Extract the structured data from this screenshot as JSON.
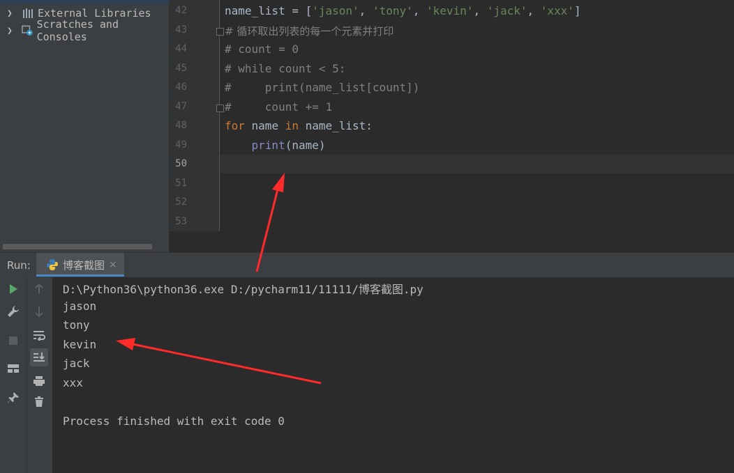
{
  "project_tree": {
    "items": [
      {
        "label": "External Libraries",
        "icon": "library-icon"
      },
      {
        "label": "Scratches and Consoles",
        "icon": "scratches-icon"
      }
    ]
  },
  "editor": {
    "lines": [
      {
        "n": "42",
        "text": "name_list = ['jason', 'tony', 'kevin', 'jack', 'xxx']"
      },
      {
        "n": "43",
        "text": "# 循环取出列表的每一个元素并打印"
      },
      {
        "n": "44",
        "text": "# count = 0"
      },
      {
        "n": "45",
        "text": "# while count < 5:"
      },
      {
        "n": "46",
        "text": "#     print(name_list[count])"
      },
      {
        "n": "47",
        "text": "#     count += 1"
      },
      {
        "n": "48",
        "text": "for name in name_list:"
      },
      {
        "n": "49",
        "text": "    print(name)"
      },
      {
        "n": "50",
        "text": ""
      },
      {
        "n": "51",
        "text": ""
      },
      {
        "n": "52",
        "text": ""
      },
      {
        "n": "53",
        "text": ""
      }
    ],
    "current_line": "50"
  },
  "run": {
    "label": "Run:",
    "tab_name": "博客截图",
    "tab_close": "×",
    "output": [
      "D:\\Python36\\python36.exe D:/pycharm11/11111/博客截图.py",
      "jason",
      "tony",
      "kevin",
      "jack",
      "xxx",
      "",
      "Process finished with exit code 0"
    ]
  },
  "colors": {
    "keyword": "#cc7832",
    "string": "#6a8759",
    "comment": "#808080",
    "builtin": "#8888c6",
    "annotation_arrow": "#ff2a2a"
  }
}
